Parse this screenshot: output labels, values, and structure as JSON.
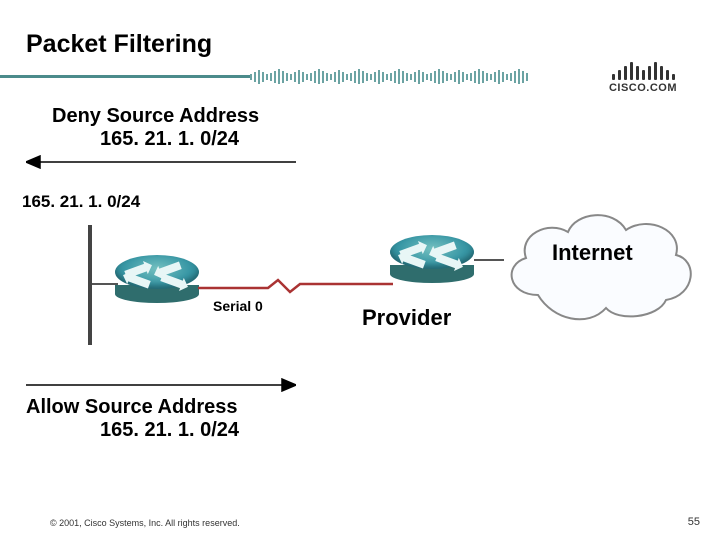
{
  "slide": {
    "title": "Packet Filtering",
    "logo_text": "CISCO.COM"
  },
  "deny": {
    "line1": "Deny Source Address",
    "line2": "165. 21. 1. 0/24"
  },
  "subnet_label": "165. 21. 1. 0/24",
  "serial_label": "Serial 0",
  "provider_label": "Provider",
  "internet_label": "Internet",
  "allow": {
    "line1": "Allow Source Address",
    "line2": "165. 21. 1. 0/24"
  },
  "footer": {
    "copyright": "© 2001, Cisco Systems, Inc. All rights reserved.",
    "page": "55"
  },
  "icons": {
    "router": "router-icon",
    "cloud": "cloud-icon",
    "arrow_left": "arrow-left-icon",
    "arrow_right": "arrow-right-icon"
  }
}
